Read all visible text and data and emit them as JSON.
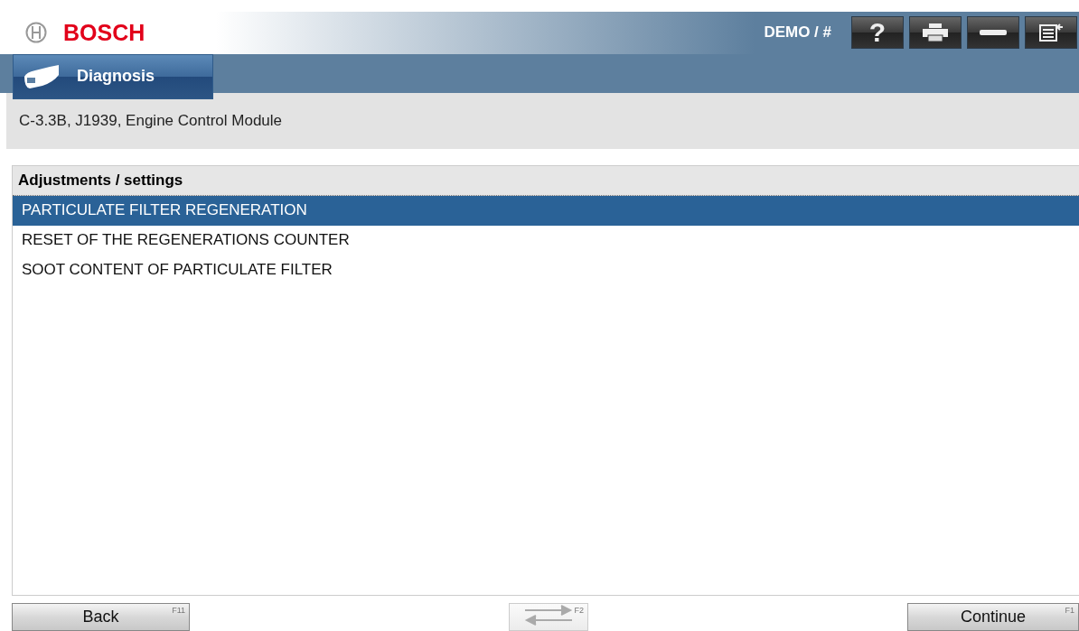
{
  "header": {
    "brand": "BOSCH",
    "user": "DEMO / #",
    "tools": [
      {
        "kind": "help",
        "label": "?"
      },
      {
        "kind": "print"
      },
      {
        "kind": "minimize"
      },
      {
        "kind": "list"
      }
    ]
  },
  "tabs": [
    {
      "label": "Diagnosis",
      "selected": true
    }
  ],
  "context": "C-3.3B, J1939, Engine Control Module",
  "list": {
    "title": "Adjustments / settings",
    "items": [
      {
        "label": "PARTICULATE FILTER REGENERATION",
        "selected": true
      },
      {
        "label": "RESET OF THE REGENERATIONS COUNTER",
        "selected": false
      },
      {
        "label": "SOOT CONTENT OF PARTICULATE FILTER",
        "selected": false
      }
    ]
  },
  "footer": [
    {
      "kind": "text",
      "label": "Back",
      "key": "F11",
      "disabled": false
    },
    {
      "kind": "swap",
      "key": "F2",
      "disabled": true
    },
    {
      "kind": "text",
      "label": "Continue",
      "key": "F1",
      "disabled": false
    }
  ]
}
